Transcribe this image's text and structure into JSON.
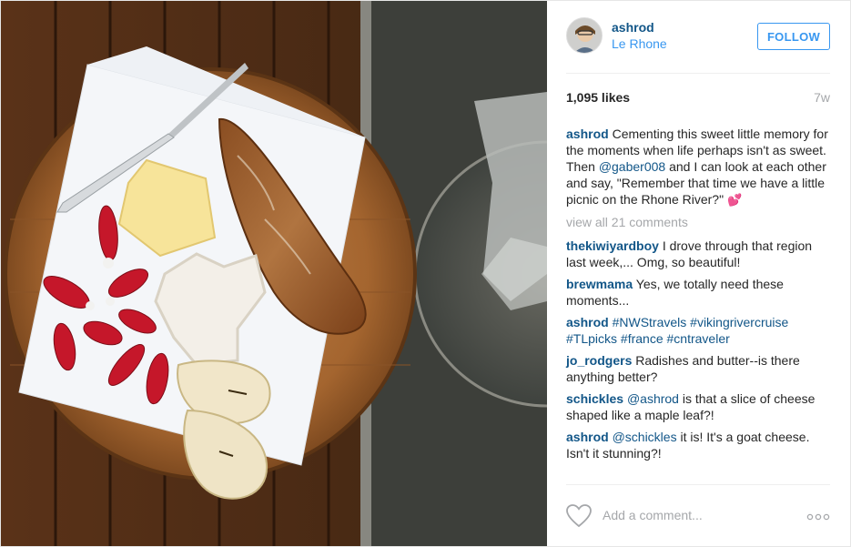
{
  "post": {
    "username": "ashrod",
    "location": "Le Rhone",
    "follow_label": "FOLLOW",
    "likes": "1,095 likes",
    "time_ago": "7w",
    "view_all_label": "view all 21 comments",
    "add_comment_placeholder": "Add a comment..."
  },
  "caption": {
    "author": "ashrod",
    "text_1": "Cementing this sweet little memory for the moments when life perhaps isn't as sweet. Then",
    "mention": "@gaber008",
    "text_2": "and I can look at each other and say, \"Remember that time we have a little picnic on the Rhone River?\"",
    "emoji": "💕"
  },
  "comments": [
    {
      "author": "thekiwiyardboy",
      "text": "I drove through that region last week,... Omg, so beautiful!"
    },
    {
      "author": "brewmama",
      "text": "Yes, we totally need these moments..."
    },
    {
      "author": "ashrod",
      "tags": [
        "#NWStravels",
        "#vikingrivercruise",
        "#TLpicks",
        "#france",
        "#cntraveler"
      ]
    },
    {
      "author": "jo_rodgers",
      "text": "Radishes and butter--is there anything better?"
    },
    {
      "author": "schickles",
      "mention": "@ashrod",
      "text": "is that a slice of cheese shaped like a maple leaf?!"
    },
    {
      "author": "ashrod",
      "mention": "@schickles",
      "text": "it is! It's a goat cheese. Isn't it stunning?!"
    }
  ],
  "icons": {
    "like": "heart-outline-icon",
    "more": "more-options-icon"
  },
  "colors": {
    "link_blue": "#125688",
    "button_blue": "#3897f0",
    "muted_gray": "#a5a7aa"
  }
}
